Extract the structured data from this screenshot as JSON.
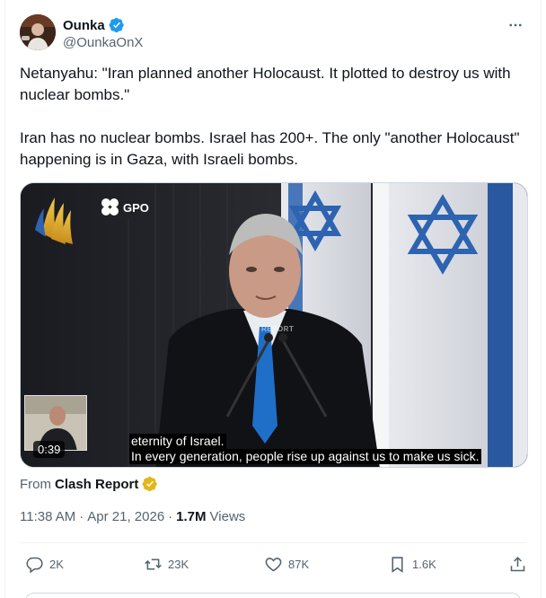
{
  "author": {
    "display_name": "Ounka",
    "handle": "@OunkaOnX",
    "verified": true,
    "verified_color": "#1d9bf0"
  },
  "more_icon": "more-horizontal-icon",
  "tweet": {
    "paragraph_1": "Netanyahu: \"Iran planned another Holocaust. It plotted to destroy us with nuclear bombs.\"",
    "paragraph_2": "Iran has no nuclear bombs. Israel has 200+. The only \"another Holocaust\" happening is in Gaza, with Israeli bombs."
  },
  "video": {
    "logo_text": "GPO",
    "duration": "0:39",
    "subtitle_line_1": "eternity of Israel.",
    "subtitle_line_2": "In every generation, people rise up against us to make us sick.",
    "watermark": "REPORT"
  },
  "source": {
    "prefix": "From",
    "name": "Clash Report",
    "badge_color": "#e2b719"
  },
  "meta": {
    "time": "11:38 AM",
    "separator": "·",
    "date": "Apr 21, 2026",
    "views_count": "1.7M",
    "views_label": "Views"
  },
  "actions": {
    "reply_count": "2K",
    "repost_count": "23K",
    "like_count": "87K",
    "bookmark_count": "1.6K"
  },
  "colors": {
    "text": "#0f1419",
    "secondary": "#536471",
    "border": "#cfd9de",
    "flag_blue": "#2d63b0"
  }
}
